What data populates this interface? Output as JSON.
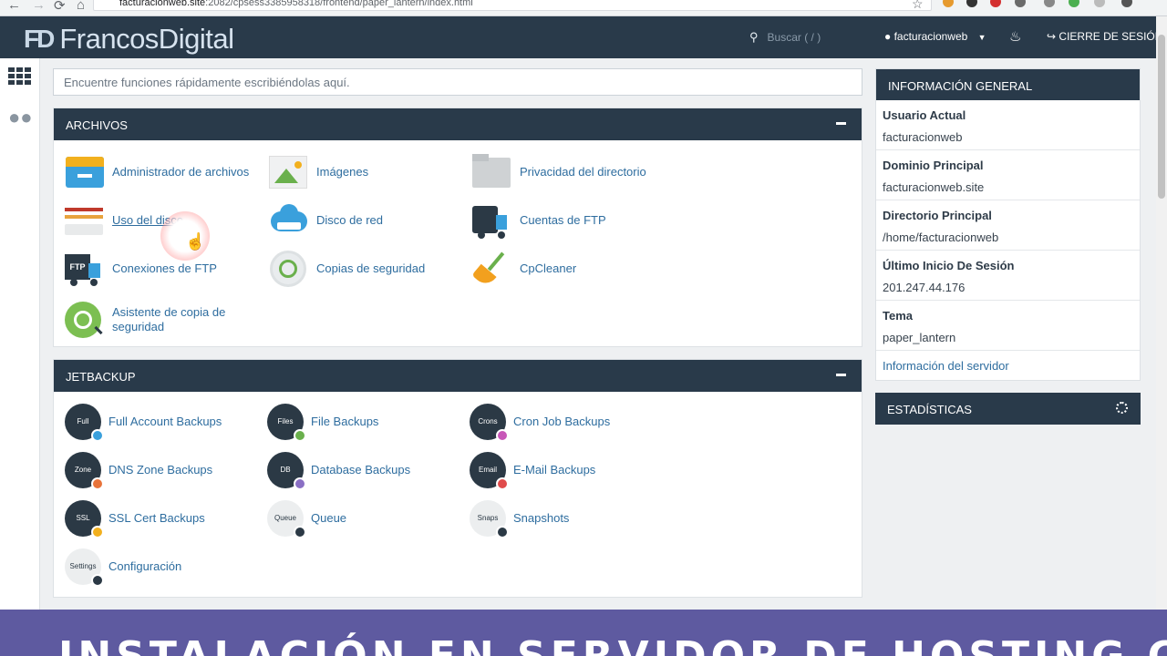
{
  "browser": {
    "back": "←",
    "forward": "→",
    "reload": "⟳",
    "home": "⌂",
    "url_host": "facturacionweb.site",
    "url_path": ":2082/cpsess3385958318/frontend/paper_lantern/index.html",
    "star": "☆"
  },
  "header": {
    "logo_mark": "FD",
    "logo_text": "FrancosDigital",
    "search_icon": "🔍",
    "search_placeholder": "Buscar ( / )",
    "user_label": "facturacionweb",
    "logout_label": "CIERRE DE SESIÓN"
  },
  "quick_search": {
    "placeholder": "Encuentre funciones rápidamente escribiéndolas aquí."
  },
  "archivos": {
    "title": "ARCHIVOS",
    "items": [
      {
        "label": "Administrador de archivos",
        "icon": "file-manager-icon"
      },
      {
        "label": "Imágenes",
        "icon": "images-icon"
      },
      {
        "label": "Privacidad del directorio",
        "icon": "folder-privacy-icon"
      },
      {
        "label": "Uso del disco",
        "icon": "disk-usage-icon"
      },
      {
        "label": "Disco de red",
        "icon": "network-disk-icon"
      },
      {
        "label": "Cuentas de FTP",
        "icon": "ftp-accounts-icon"
      },
      {
        "label": "Conexiones de FTP",
        "icon": "ftp-connections-icon"
      },
      {
        "label": "Copias de seguridad",
        "icon": "backup-icon"
      },
      {
        "label": "CpCleaner",
        "icon": "broom-icon"
      },
      {
        "label": "Asistente de copia de seguridad",
        "icon": "backup-wizard-icon"
      }
    ]
  },
  "jetbackup": {
    "title": "JETBACKUP",
    "items": [
      {
        "label": "Full Account Backups",
        "badge": "Full"
      },
      {
        "label": "File Backups",
        "badge": "Files"
      },
      {
        "label": "Cron Job Backups",
        "badge": "Crons"
      },
      {
        "label": "DNS Zone Backups",
        "badge": "Zone"
      },
      {
        "label": "Database Backups",
        "badge": "DB"
      },
      {
        "label": "E-Mail Backups",
        "badge": "Email"
      },
      {
        "label": "SSL Cert Backups",
        "badge": "SSL"
      },
      {
        "label": "Queue",
        "badge": "Queue"
      },
      {
        "label": "Snapshots",
        "badge": "Snaps"
      },
      {
        "label": "Configuración",
        "badge": "Settings"
      }
    ]
  },
  "info": {
    "title": "INFORMACIÓN GENERAL",
    "rows": [
      {
        "key": "Usuario Actual",
        "value": "facturacionweb"
      },
      {
        "key": "Dominio Principal",
        "value": "facturacionweb.site"
      },
      {
        "key": "Directorio Principal",
        "value": "/home/facturacionweb"
      },
      {
        "key": "Último Inicio De Sesión",
        "value": "201.247.44.176"
      },
      {
        "key": "Tema",
        "value": "paper_lantern"
      }
    ],
    "server_link": "Información del servidor"
  },
  "stats": {
    "title": "ESTADÍSTICAS"
  },
  "banner": {
    "text": "INSTALACIÓN EN SERVIDOR DE HOSTING COMPARTIDO"
  },
  "colors": {
    "header": "#293a4a",
    "link": "#2e6d9f",
    "banner": "#5e5aa0"
  }
}
